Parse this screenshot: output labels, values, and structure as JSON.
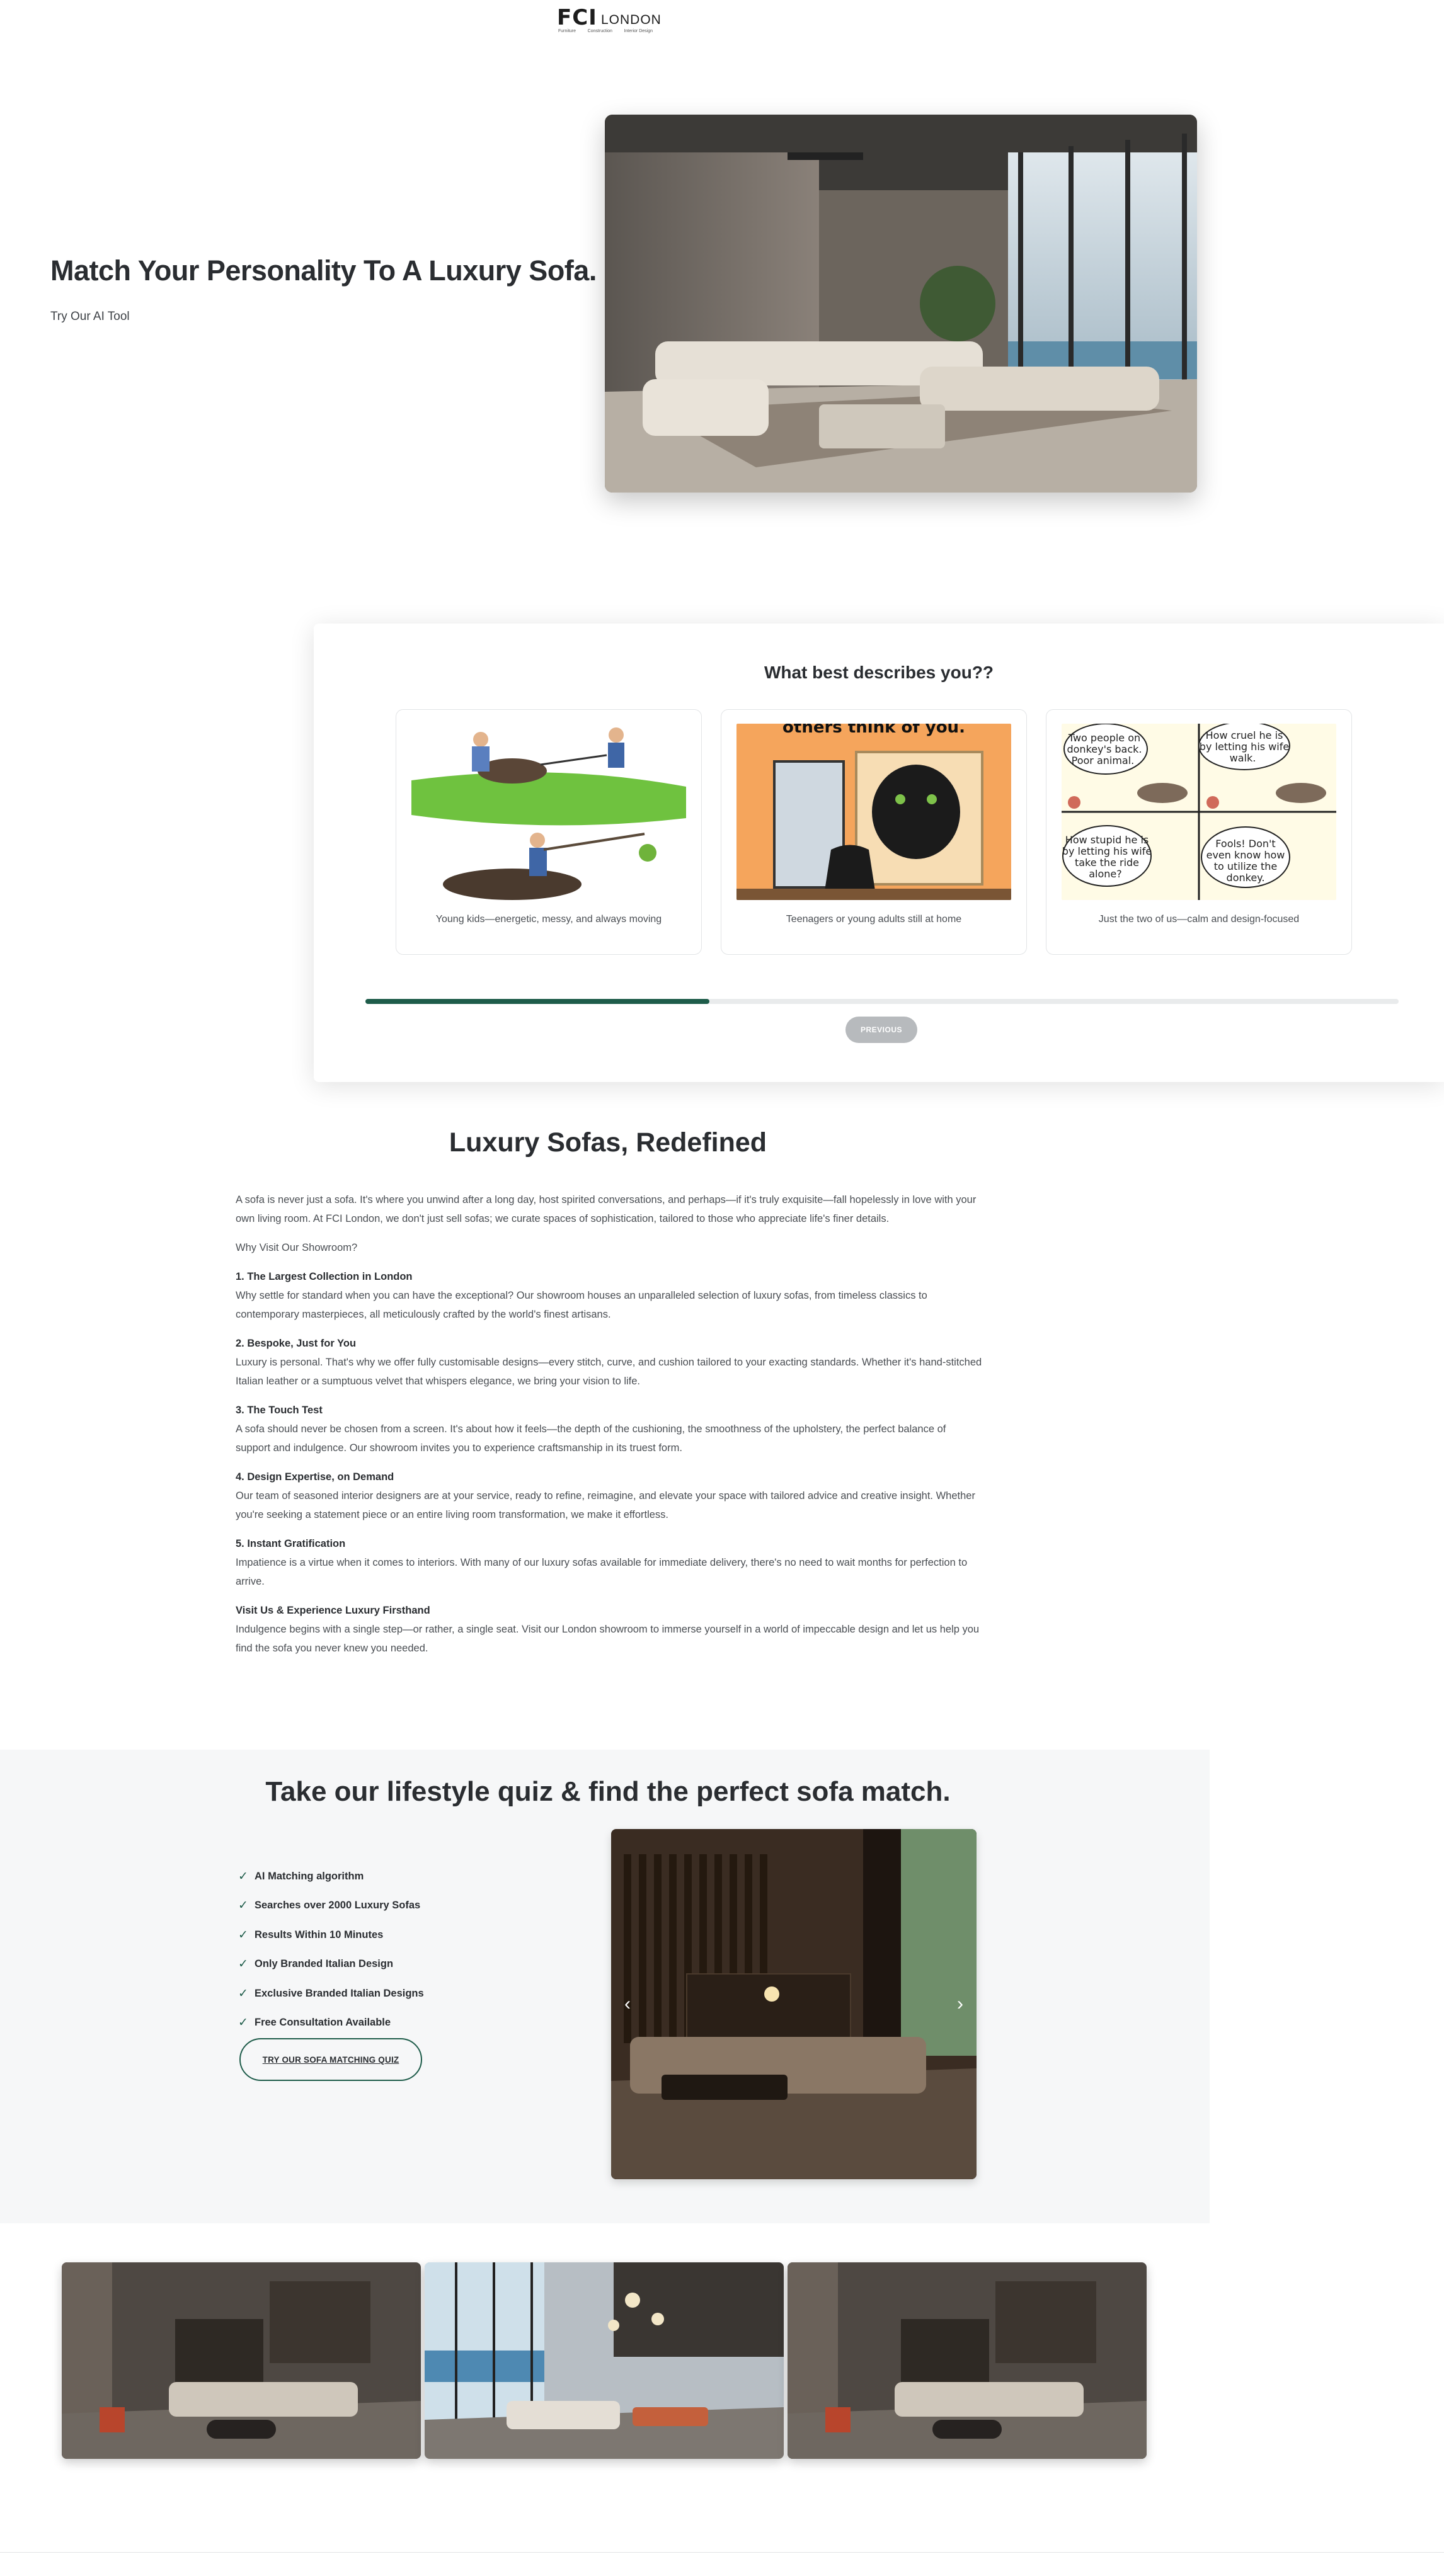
{
  "brand": {
    "logo_main": "FCI",
    "logo_city": "LONDON",
    "logo_taglines": [
      "Furniture",
      "Construction",
      "Interior Design"
    ]
  },
  "hero": {
    "title": "Match Your Personality To A Luxury Sofa.",
    "link": "Try Our AI Tool"
  },
  "quiz": {
    "question": "What best describes you??",
    "options": [
      {
        "label": "Young kids—energetic, messy, and always moving"
      },
      {
        "label": "Teenagers or young adults still at home",
        "image_text": "others think of you."
      },
      {
        "label": "Just the two of us—calm and design-focused",
        "bubbles": [
          "Two people on donkey's back. Poor animal.",
          "How cruel he is by letting his wife walk.",
          "How stupid he is by letting his wife take the ride alone?",
          "Fools! Don't even know how to utilize the donkey."
        ]
      }
    ],
    "progress": 0.333,
    "previous_label": "PREVIOUS",
    "accent": "#1e5c4a"
  },
  "article": {
    "title": "Luxury Sofas, Redefined",
    "intro": "A sofa is never just a sofa. It's where you unwind after a long day, host spirited conversations, and perhaps—if it's truly exquisite—fall hopelessly in love with your own living room. At FCI London, we don't just sell sofas; we curate spaces of sophistication, tailored to those who appreciate life's finer details.",
    "why": "Why Visit Our Showroom?",
    "sections": [
      {
        "heading": "1. The Largest Collection in London",
        "body": "Why settle for standard when you can have the exceptional? Our showroom houses an unparalleled selection of luxury sofas, from timeless classics to contemporary masterpieces, all meticulously crafted by the world's finest artisans."
      },
      {
        "heading": "2. Bespoke, Just for You",
        "body": "Luxury is personal. That's why we offer fully customisable designs—every stitch, curve, and cushion tailored to your exacting standards. Whether it's hand-stitched Italian leather or a sumptuous velvet that whispers elegance, we bring your vision to life."
      },
      {
        "heading": "3. The Touch Test",
        "body": "A sofa should never be chosen from a screen. It's about how it feels—the depth of the cushioning, the smoothness of the upholstery, the perfect balance of support and indulgence. Our showroom invites you to experience craftsmanship in its truest form."
      },
      {
        "heading": "4. Design Expertise, on Demand",
        "body": "Our team of seasoned interior designers are at your service, ready to refine, reimagine, and elevate your space with tailored advice and creative insight. Whether you're seeking a statement piece or an entire living room transformation, we make it effortless."
      },
      {
        "heading": "5. Instant Gratification",
        "body": "Impatience is a virtue when it comes to interiors. With many of our luxury sofas available for immediate delivery, there's no need to wait months for perfection to arrive."
      },
      {
        "heading": "Visit Us & Experience Luxury Firsthand",
        "body": "Indulgence begins with a single step—or rather, a single seat. Visit our London showroom to immerse yourself in a world of impeccable design and let us help you find the sofa you never knew you needed."
      }
    ]
  },
  "lifestyle": {
    "title": "Take our lifestyle quiz & find the perfect sofa match.",
    "features": [
      "AI Matching algorithm",
      "Searches over 2000 Luxury Sofas",
      "Results Within 10 Minutes",
      "Only Branded Italian Design",
      "Exclusive Branded Italian Designs",
      "Free Consultation Available"
    ],
    "cta": "TRY OUR SOFA MATCHING QUIZ",
    "prev_arrow": "‹",
    "next_arrow": "›"
  }
}
